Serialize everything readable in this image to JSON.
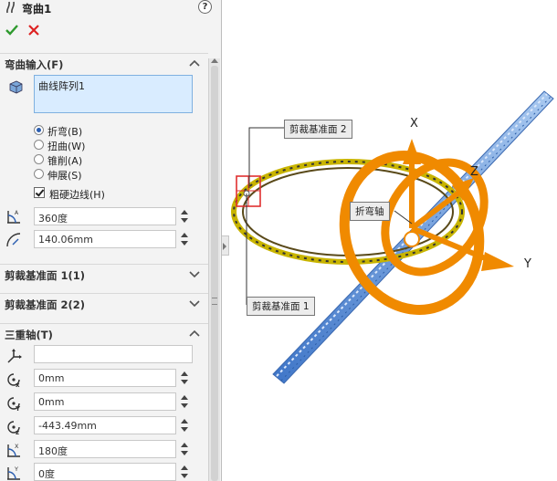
{
  "panel": {
    "title": "弯曲1",
    "help": "?",
    "groups": {
      "bend_input": {
        "title": "弯曲输入(F)",
        "selection": "曲线阵列1",
        "options": [
          "折弯(B)",
          "扭曲(W)",
          "锥削(A)",
          "伸展(S)"
        ],
        "selected_option": "折弯(B)",
        "hard_edges_label": "粗硬边线(H)",
        "hard_edges_checked": true,
        "angle_value": "360度",
        "radius_value": "140.06mm"
      },
      "trim_plane_1": {
        "title": "剪裁基准面 1(1)"
      },
      "trim_plane_2": {
        "title": "剪裁基准面 2(2)"
      },
      "triad": {
        "title": "三重轴(T)",
        "selection": "",
        "x_value": "0mm",
        "y_value": "0mm",
        "z_value": "-443.49mm",
        "rot_x_value": "180度",
        "rot_y_value": "0度"
      }
    }
  },
  "viewport": {
    "callouts": {
      "trim_plane_2": "剪裁基准面 2",
      "trim_plane_1": "剪裁基准面 1",
      "bend_axis": "折弯轴"
    },
    "axes": {
      "x": "X",
      "y": "Y",
      "z": "Z"
    },
    "colors": {
      "triad": "#f08a00",
      "part": "#5b8fd6",
      "ring": "#c8b400",
      "trim_box": "#e03030"
    }
  }
}
